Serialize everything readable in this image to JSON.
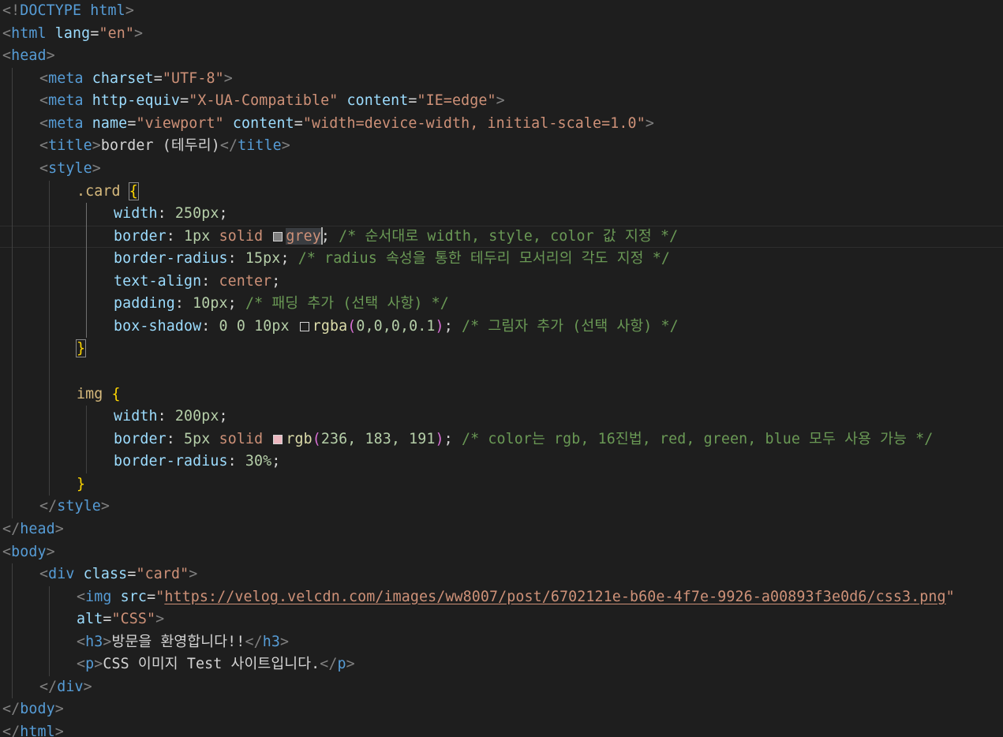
{
  "editor": {
    "swatch_colors": {
      "grey": "#808080",
      "shadow": "#1e1e1e",
      "pink": "#ecb7bf"
    },
    "lines": [
      [
        "<!",
        "DOCTYPE",
        " ",
        "html",
        ">"
      ],
      [
        "<",
        "html",
        " ",
        "lang",
        "=",
        "\"en\"",
        ">"
      ],
      [
        "<",
        "head",
        ">"
      ],
      [
        "<",
        "meta",
        " ",
        "charset",
        "=",
        "\"UTF-8\"",
        ">"
      ],
      [
        "<",
        "meta",
        " ",
        "http-equiv",
        "=",
        "\"X-UA-Compatible\"",
        " ",
        "content",
        "=",
        "\"IE=edge\"",
        ">"
      ],
      [
        "<",
        "meta",
        " ",
        "name",
        "=",
        "\"viewport\"",
        " ",
        "content",
        "=",
        "\"width=device-width, initial-scale=1.0\"",
        ">"
      ],
      [
        "<",
        "title",
        ">",
        "border (테두리)",
        "</",
        "title",
        ">"
      ],
      [
        "<",
        "style",
        ">"
      ],
      [
        ".card",
        " ",
        "{"
      ],
      [
        "width",
        ": ",
        "250px",
        ";"
      ],
      [
        "border",
        ": ",
        "1px",
        " ",
        "solid",
        " ",
        "",
        "grey",
        "",
        "; ",
        "/* 순서대로 width, style, color 값 지정 */"
      ],
      [
        "border-radius",
        ": ",
        "15px",
        "; ",
        "/* radius 속성을 통한 테두리 모서리의 각도 지정 */"
      ],
      [
        "text-align",
        ": ",
        "center",
        ";"
      ],
      [
        "padding",
        ": ",
        "10px",
        "; ",
        "/* 패딩 추가 (선택 사항) */"
      ],
      [
        "box-shadow",
        ": ",
        "0",
        " ",
        "0",
        " ",
        "10px",
        " ",
        "",
        "rgba",
        "(",
        "0,0,0,0.1",
        ")",
        "; ",
        "/* 그림자 추가 (선택 사항) */"
      ],
      [
        "}"
      ],
      [],
      [
        "img",
        " ",
        "{"
      ],
      [
        "width",
        ": ",
        "200px",
        ";"
      ],
      [
        "border",
        ": ",
        "5px",
        " ",
        "solid",
        " ",
        "",
        "rgb",
        "(",
        "236, 183, 191",
        ")",
        "; ",
        "/* color는 rgb, 16진법, red, green, blue 모두 사용 가능 */"
      ],
      [
        "border-radius",
        ": ",
        "30%",
        ";"
      ],
      [
        "}"
      ],
      [
        "</",
        "style",
        ">"
      ],
      [
        "</",
        "head",
        ">"
      ],
      [
        "<",
        "body",
        ">"
      ],
      [
        "<",
        "div",
        " ",
        "class",
        "=",
        "\"card\"",
        ">"
      ],
      [
        "<",
        "img",
        " ",
        "src",
        "=",
        "\"",
        "https://velog.velcdn.com/images/ww8007/post/6702121e-b60e-4f7e-9926-a00893f3e0d6/css3.png",
        "\""
      ],
      [
        "alt",
        "=",
        "\"CSS\"",
        ">"
      ],
      [
        "<",
        "h3",
        ">",
        "방문을 환영합니다!!",
        "</",
        "h3",
        ">"
      ],
      [
        "<",
        "p",
        ">",
        "CSS 이미지 Test 사이트입니다.",
        "</",
        "p",
        ">"
      ],
      [
        "</",
        "div",
        ">"
      ],
      [
        "</",
        "body",
        ">"
      ],
      [
        "</",
        "html",
        ">"
      ]
    ]
  }
}
